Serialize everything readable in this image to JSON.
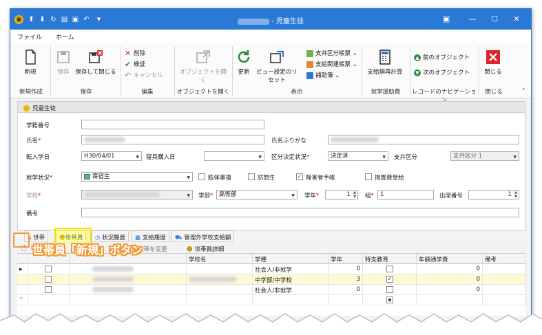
{
  "window": {
    "title": "- 児童生徒"
  },
  "menu": {
    "file": "ファイル",
    "home": "ホーム"
  },
  "ribbon": {
    "new": "新規",
    "new_group": "新規作成",
    "save": "保存",
    "save_close": "保存して閉じる",
    "save_group": "保存",
    "delete": "削除",
    "validate": "検証",
    "cancel": "キャンセル",
    "edit_group": "編集",
    "open_object": "オブジェクトを開く",
    "open_group": "オブジェクトを開く",
    "refresh": "更新",
    "view_reset": "ビュー設定のリセット",
    "form_payment": "支弁区分帳票",
    "form_related": "支給関連帳票",
    "aux": "補助簿",
    "display_group": "表示",
    "recalc": "支給額再計算",
    "aid_group": "就学援助費",
    "prev_object": "前のオブジェクト",
    "next_object": "次のオブジェクト",
    "nav_group": "レコードのナビゲーション",
    "close": "閉じる",
    "close_group": "閉じる"
  },
  "panel": {
    "title": "児童生徒"
  },
  "form": {
    "student_no_label": "学籍番号",
    "name_label": "氏名",
    "kana_label": "氏名ふりがな",
    "transfer_date_label": "転入学日",
    "transfer_date": "H30/04/01",
    "dorm_date_label": "寝具購入日",
    "decision_label": "区分決定状況",
    "decision": "決定済",
    "payment_label": "支弁区分",
    "payment": "支弁区分 1",
    "status_label": "就学状況",
    "status": "寄宿生",
    "chk_disease": "肢体重複",
    "chk_visit": "訪問生",
    "chk_disability": "障害者手帳",
    "chk_measure": "措置費受給",
    "school_label": "学校",
    "dept_label": "学部",
    "dept": "高等部",
    "grade_label": "学年",
    "grade": "1",
    "class_label": "組",
    "class": "1",
    "seat_label": "出席番号",
    "seat": "1",
    "note_label": "備考"
  },
  "tabs": {
    "t1": "世帯",
    "t2": "世帯員",
    "t3": "状況履歴",
    "t4": "支給履歴",
    "t5": "管理外学校支給額"
  },
  "gridtool": {
    "change_household": "所属世帯を変更",
    "member_detail": "世帯員詳細"
  },
  "grid": {
    "headers": [
      "",
      "",
      "",
      "学校名",
      "学種",
      "学年",
      "特支教育",
      "年額通学費",
      "備考"
    ],
    "rows": [
      {
        "type": "社会人/非就学",
        "grade": "0",
        "special": false,
        "fee": "0"
      },
      {
        "type": "中学部/中学校",
        "grade": "3",
        "special": true,
        "fee": "0"
      },
      {
        "type": "社会人/非就学",
        "grade": "0",
        "special": false,
        "fee": "0"
      }
    ]
  },
  "callout": {
    "text": "世帯員「新規」ボタン"
  }
}
